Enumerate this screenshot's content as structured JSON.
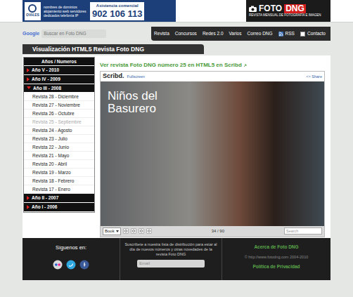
{
  "ad": {
    "brand": "OVH.ES",
    "services": "nombres de dominios alojamiento web servidores dedicados telefonía IP",
    "label": "Asistencia comercial",
    "phone": "902 106 113"
  },
  "logo": {
    "name": "FOTO",
    "accent": "DNG",
    "tagline": "REVISTA MENSUAL DE FOTOGRAFÍA E IMAGEN"
  },
  "search": {
    "brand": "Google",
    "placeholder": "Buscar en Foto DNG"
  },
  "nav": [
    {
      "label": "Revista",
      "kind": "text"
    },
    {
      "label": "Concursos",
      "kind": "text"
    },
    {
      "label": "Redes 2.0",
      "kind": "text"
    },
    {
      "label": "Varios",
      "kind": "text"
    },
    {
      "label": "Correo DNG",
      "kind": "text"
    },
    {
      "label": "RSS",
      "kind": "rss"
    },
    {
      "label": "Contacto",
      "kind": "box"
    }
  ],
  "page_title": "Visualización HTML5 Revista Foto DNG",
  "sidebar": {
    "title": "Años / Numeros",
    "years": [
      {
        "label": "Año V - 2010",
        "expanded": false,
        "issues": []
      },
      {
        "label": "Año IV - 2009",
        "expanded": false,
        "issues": []
      },
      {
        "label": "Año III - 2008",
        "expanded": true,
        "issues": [
          {
            "label": "Revista 28 - Diciembre",
            "selected": false
          },
          {
            "label": "Revista 27 - Noviembre",
            "selected": false
          },
          {
            "label": "Revista 26 - Octubre",
            "selected": false
          },
          {
            "label": "Revista 25 - Septiembre",
            "selected": true
          },
          {
            "label": "Revista 24 - Agosto",
            "selected": false
          },
          {
            "label": "Revista 23 - Julio",
            "selected": false
          },
          {
            "label": "Revista 22 - Junio",
            "selected": false
          },
          {
            "label": "Revista 21 - Mayo",
            "selected": false
          },
          {
            "label": "Revista 20 - Abril",
            "selected": false
          },
          {
            "label": "Revista 19 - Marzo",
            "selected": false
          },
          {
            "label": "Revista 18 - Febrero",
            "selected": false
          },
          {
            "label": "Revista 17 - Enero",
            "selected": false
          }
        ]
      },
      {
        "label": "Año II - 2007",
        "expanded": false,
        "issues": []
      },
      {
        "label": "Año I - 2006",
        "expanded": false,
        "issues": []
      }
    ]
  },
  "viewer": {
    "link": "Ver revista Foto DNG número 25 en HTML5 en Scribd",
    "brand": "Scribd.",
    "fullscreen": "Fullscreen",
    "share": "<> Share",
    "cover_title": "Niños del Basurero",
    "mode": "Book",
    "page": "34 / 90",
    "search_placeholder": "Search"
  },
  "footer": {
    "follow": "Síguenos en:",
    "subscribe": "Suscríbete a nuestra lista de distribución para estar al día de nuevos números y otras novedades de la revista Foto DNG",
    "email_placeholder": "Email",
    "about": "Acerca de Foto DNG",
    "copyright": "© http://www.fotodng.com 2004-2010",
    "privacy": "Política de Privacidad"
  }
}
